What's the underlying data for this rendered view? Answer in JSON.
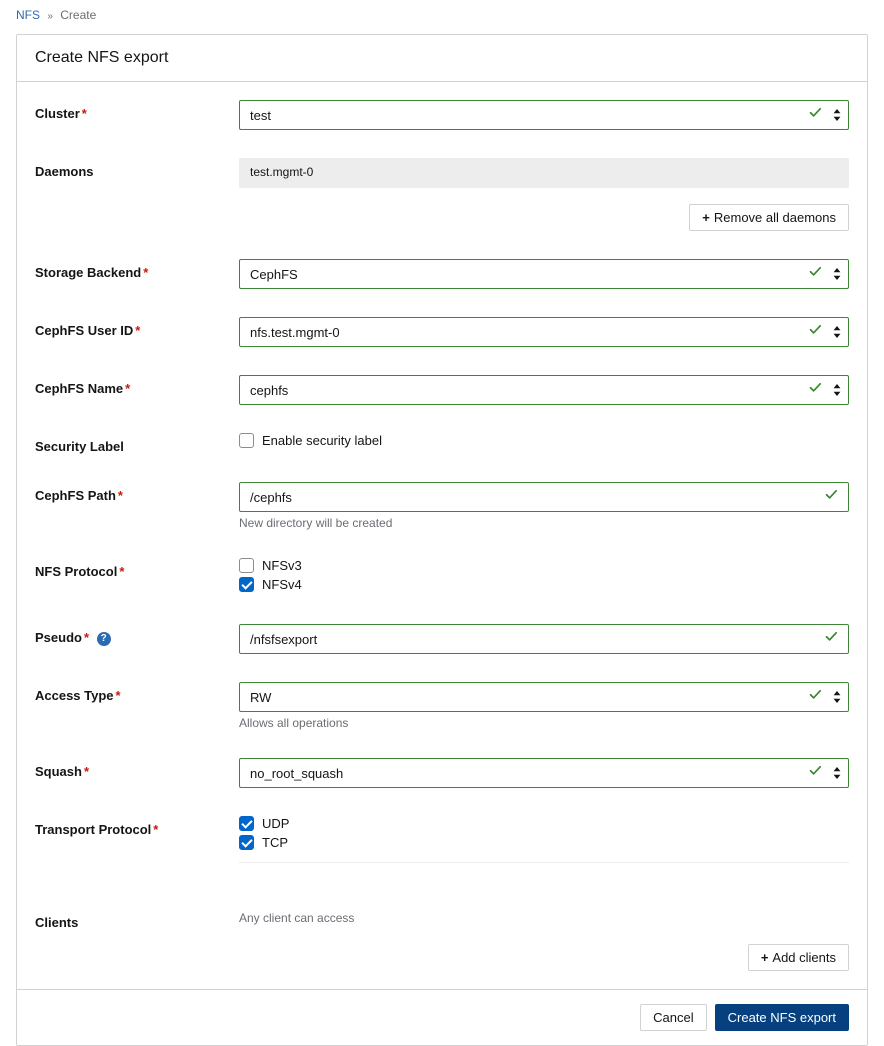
{
  "breadcrumb": {
    "root": "NFS",
    "current": "Create"
  },
  "header": {
    "title": "Create NFS export"
  },
  "labels": {
    "cluster": "Cluster",
    "daemons": "Daemons",
    "storage_backend": "Storage Backend",
    "cephfs_user_id": "CephFS User ID",
    "cephfs_name": "CephFS Name",
    "security_label": "Security Label",
    "cephfs_path": "CephFS Path",
    "nfs_protocol": "NFS Protocol",
    "pseudo": "Pseudo",
    "access_type": "Access Type",
    "squash": "Squash",
    "transport_protocol": "Transport Protocol",
    "clients": "Clients"
  },
  "values": {
    "cluster": "test",
    "daemon_tag": "test.mgmt-0",
    "storage_backend": "CephFS",
    "cephfs_user_id": "nfs.test.mgmt-0",
    "cephfs_name": "cephfs",
    "cephfs_path": "/cephfs",
    "pseudo": "/nfsfsexport",
    "access_type": "RW",
    "squash": "no_root_squash"
  },
  "checkboxes": {
    "enable_security_label": "Enable security label",
    "nfsv3": "NFSv3",
    "nfsv4": "NFSv4",
    "udp": "UDP",
    "tcp": "TCP"
  },
  "helpers": {
    "cephfs_path": "New directory will be created",
    "access_type": "Allows all operations",
    "clients": "Any client can access"
  },
  "buttons": {
    "remove_all_daemons": "Remove all daemons",
    "add_clients": "Add clients",
    "cancel": "Cancel",
    "submit": "Create NFS export"
  }
}
